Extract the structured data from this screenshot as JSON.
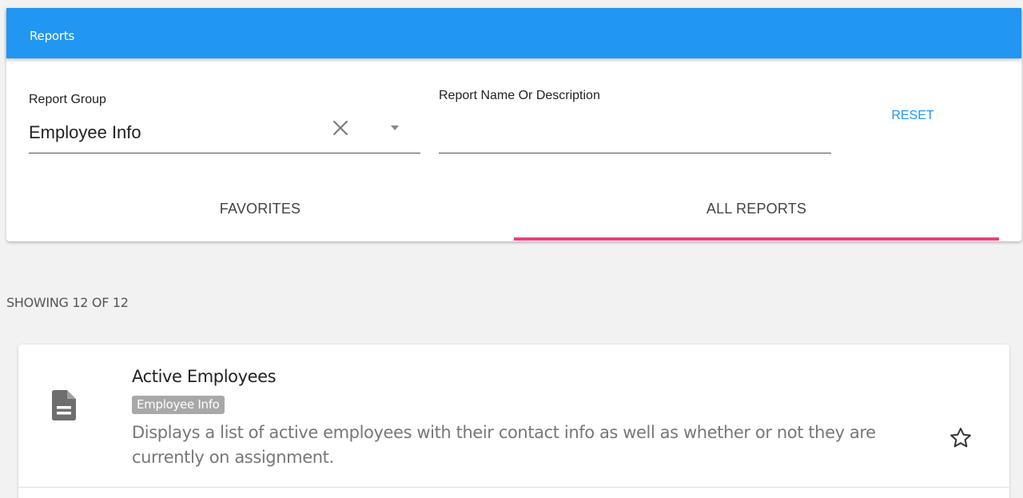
{
  "appbar": {
    "title": "Reports"
  },
  "filters": {
    "report_group": {
      "label": "Report Group",
      "value": "Employee Info"
    },
    "search": {
      "label": "Report Name Or Description",
      "value": ""
    },
    "reset_label": "RESET"
  },
  "tabs": [
    {
      "label": "FAVORITES",
      "selected": false
    },
    {
      "label": "ALL REPORTS",
      "selected": true
    }
  ],
  "results": {
    "summary": "SHOWING 12 OF 12"
  },
  "reports": [
    {
      "title": "Active Employees",
      "group": "Employee Info",
      "description": "Displays a list of active employees with their contact info as well as whether or not they are currently on assignment.",
      "icon": "document-icon",
      "favorite_icon": "star-outline-icon"
    }
  ],
  "colors": {
    "primary": "#2196f3",
    "tab_indicator": "#ec407a",
    "badge": "#a8a8a8",
    "background": "#f2f2f2"
  }
}
